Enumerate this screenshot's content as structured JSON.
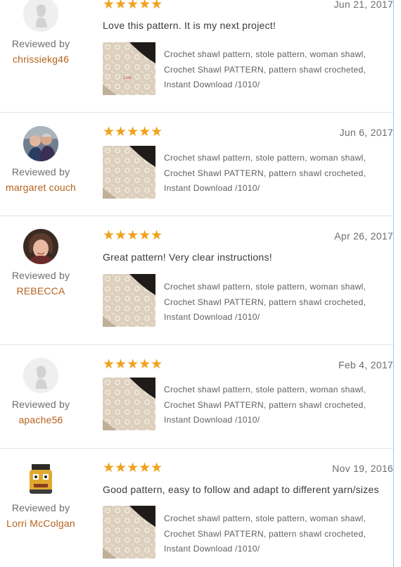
{
  "reviews": [
    {
      "date": "Jun 21, 2017",
      "rating": "★★★★★",
      "reviewed_by_label": "Reviewed by",
      "reviewer": "chrissiekg46",
      "avatar": "default-avatar-icon",
      "comment": "Love this pattern. It is my next project!",
      "item_title": "Crochet shawl pattern, stole pattern, woman shawl, Crochet Shawl PATTERN, pattern shawl crocheted, Instant Download /1010/"
    },
    {
      "date": "Jun 6, 2017",
      "rating": "★★★★★",
      "reviewed_by_label": "Reviewed by",
      "reviewer": "margaret couch",
      "avatar": "photo-avatar-couple",
      "comment": "",
      "item_title": "Crochet shawl pattern, stole pattern, woman shawl, Crochet Shawl PATTERN, pattern shawl crocheted, Instant Download /1010/"
    },
    {
      "date": "Apr 26, 2017",
      "rating": "★★★★★",
      "reviewed_by_label": "Reviewed by",
      "reviewer": "REBECCA",
      "avatar": "photo-avatar-woman",
      "comment": "Great pattern! Very clear instructions!",
      "item_title": "Crochet shawl pattern, stole pattern, woman shawl, Crochet Shawl PATTERN, pattern shawl crocheted, Instant Download /1010/"
    },
    {
      "date": "Feb 4, 2017",
      "rating": "★★★★★",
      "reviewed_by_label": "Reviewed by",
      "reviewer": "apache56",
      "avatar": "default-avatar-icon",
      "comment": "",
      "item_title": "Crochet shawl pattern, stole pattern, woman shawl, Crochet Shawl PATTERN, pattern shawl crocheted, Instant Download /1010/"
    },
    {
      "date": "Nov 19, 2016",
      "rating": "★★★★★",
      "reviewed_by_label": "Reviewed by",
      "reviewer": "Lorri McColgan",
      "avatar": "photo-avatar-cartoon",
      "comment": "Good pattern, easy to follow and adapt to different yarn/sizes",
      "item_title": "Crochet shawl pattern, stole pattern, woman shawl, Crochet Shawl PATTERN, pattern shawl crocheted, Instant Download /1010/"
    }
  ],
  "colors": {
    "star": "#f0a21b",
    "reviewer_link": "#b6621d",
    "divider": "#e2e2e2",
    "right_edge": "#8fd0e6"
  }
}
